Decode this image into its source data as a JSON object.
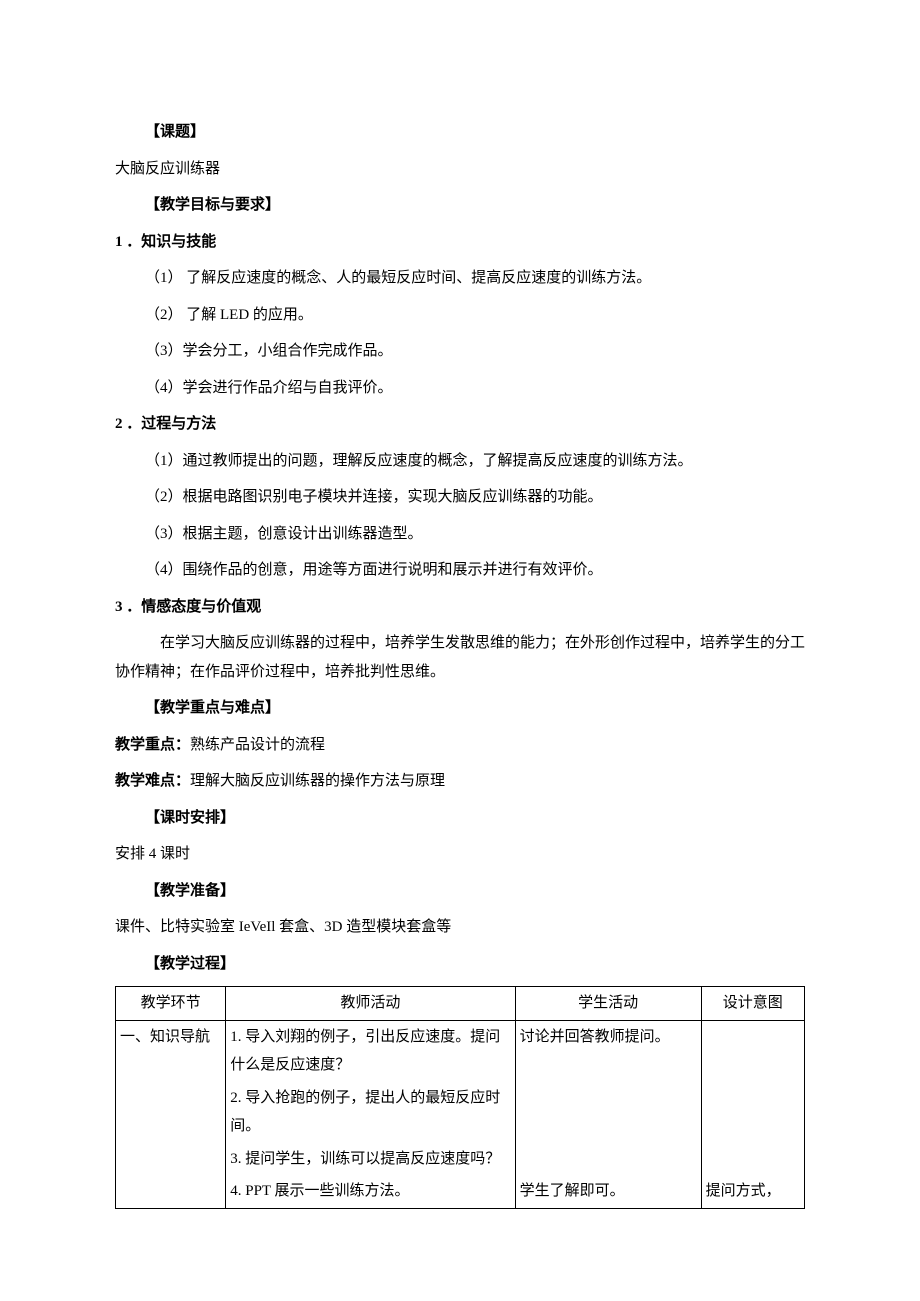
{
  "headings": {
    "topic": "【课题】",
    "goals": "【教学目标与要求】",
    "key_diff": "【教学重点与难点】",
    "schedule": "【课时安排】",
    "prep": "【教学准备】",
    "process": "【教学过程】"
  },
  "subtitle": "大脑反应训练器",
  "s1": {
    "head": "1 ．知识与技能",
    "items": [
      "（1） 了解反应速度的概念、人的最短反应时间、提高反应速度的训练方法。",
      "（2） 了解 LED 的应用。",
      "（3）学会分工，小组合作完成作品。",
      "（4）学会进行作品介绍与自我评价。"
    ]
  },
  "s2": {
    "head": "2 ．过程与方法",
    "items": [
      "（1）通过教师提出的问题，理解反应速度的概念，了解提高反应速度的训练方法。",
      "（2）根据电路图识别电子模块并连接，实现大脑反应训练器的功能。",
      "（3）根据主题，创意设计出训练器造型。",
      "（4）围绕作品的创意，用途等方面进行说明和展示并进行有效评价。"
    ]
  },
  "s3": {
    "head": "3 ．情感态度与价值观",
    "para": "在学习大脑反应训练器的过程中，培养学生发散思维的能力；在外形创作过程中，培养学生的分工协作精神；在作品评价过程中，培养批判性思维。"
  },
  "kd": {
    "focus_label": "教学重点：",
    "focus_text": "熟练产品设计的流程",
    "diff_label": "教学难点：",
    "diff_text": "理解大脑反应训练器的操作方法与原理"
  },
  "schedule_text": "安排 4 课时",
  "prep_text": "课件、比特实验室 IeVeIl 套盒、3D 造型模块套盒等",
  "table": {
    "headers": [
      "教学环节",
      "教师活动",
      "学生活动",
      "设计意图"
    ],
    "rows": [
      {
        "c1": "一、知识导航",
        "c2": "1. 导入刘翔的例子，引出反应速度。提问什么是反应速度？",
        "c3": "讨论并回答教师提问。",
        "c4": ""
      },
      {
        "c1": "",
        "c2": "2. 导入抢跑的例子，提出人的最短反应时间。",
        "c3": "",
        "c4": ""
      },
      {
        "c1": "",
        "c2": "3. 提问学生，训练可以提高反应速度吗？",
        "c3": "",
        "c4": ""
      },
      {
        "c1": "",
        "c2": "4. PPT 展示一些训练方法。",
        "c3": "学生了解即可。",
        "c4": "提问方式，"
      }
    ]
  }
}
